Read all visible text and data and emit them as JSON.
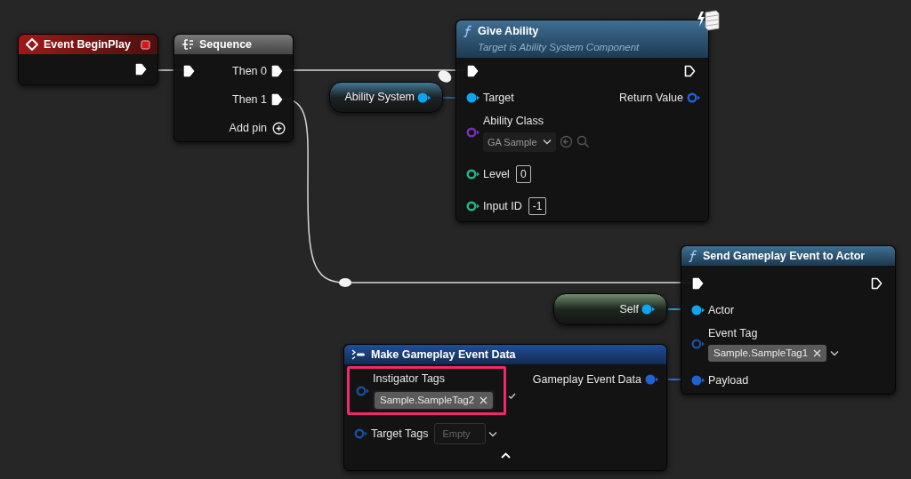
{
  "event_begin_play": {
    "title": "Event BeginPlay",
    "exec_out": {
      "connected": true
    }
  },
  "sequence": {
    "title": "Sequence",
    "exec_in": {
      "connected": true
    },
    "outputs": [
      {
        "label": "Then 0",
        "connected": true
      },
      {
        "label": "Then 1",
        "connected": true
      }
    ],
    "add_pin": "Add pin"
  },
  "give_ability": {
    "title": "Give Ability",
    "subtitle": "Target is Ability System Component",
    "exec_in": {
      "connected": true
    },
    "exec_out": {
      "connected": false
    },
    "target": {
      "label": "Target",
      "connected": true,
      "color": "#0ea5f0"
    },
    "return_value": {
      "label": "Return Value",
      "connected": false,
      "color": "#1e63d6"
    },
    "ability_class": {
      "label": "Ability Class",
      "connected": false,
      "color": "#7a2fc0",
      "value": "GA Sample"
    },
    "level": {
      "label": "Level",
      "connected": false,
      "color": "#22b58c",
      "value": "0"
    },
    "input_id": {
      "label": "Input ID",
      "connected": false,
      "color": "#22b58c",
      "value": "-1"
    }
  },
  "ability_system_variable": {
    "label": "Ability System",
    "connected": true,
    "color": "#0ea5f0"
  },
  "self_variable": {
    "label": "Self",
    "connected": true,
    "color": "#0ea5f0"
  },
  "send_gameplay_event": {
    "title": "Send Gameplay Event to Actor",
    "exec_in": {
      "connected": true
    },
    "exec_out": {
      "connected": false
    },
    "actor": {
      "label": "Actor",
      "connected": true,
      "color": "#0ea5f0"
    },
    "event_tag": {
      "label": "Event Tag",
      "connected": false,
      "color": "#1a4f9a",
      "tag": "Sample.SampleTag1"
    },
    "payload": {
      "label": "Payload",
      "connected": true,
      "color": "#1e63d6"
    }
  },
  "make_gameplay_event_data": {
    "title": "Make Gameplay Event Data",
    "instigator_tags": {
      "label": "Instigator Tags",
      "connected": false,
      "color": "#1a4f9a",
      "tag": "Sample.SampleTag2",
      "highlighted": true
    },
    "target_tags": {
      "label": "Target Tags",
      "connected": false,
      "color": "#1a4f9a",
      "placeholder": "Empty"
    },
    "output": {
      "label": "Gameplay Event Data",
      "connected": true,
      "color": "#1e63d6"
    }
  }
}
